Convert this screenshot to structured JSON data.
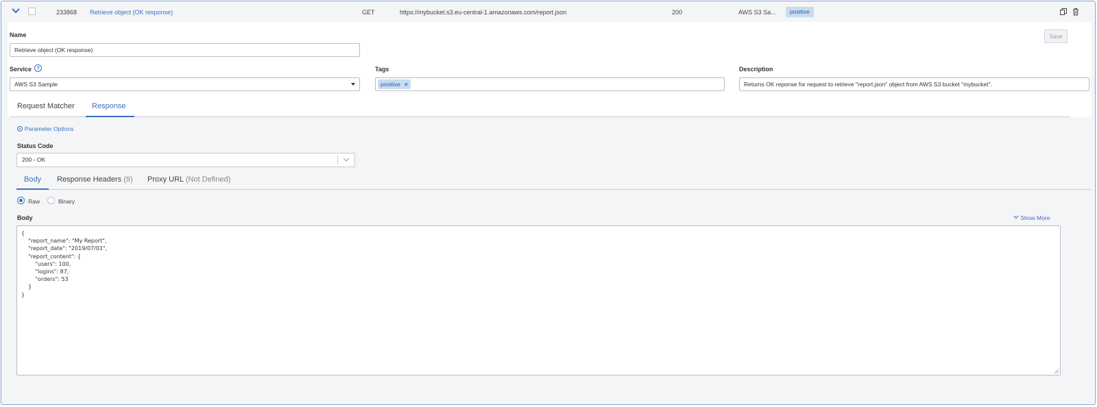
{
  "row": {
    "id": "233868",
    "name": "Retrieve object (OK response)",
    "method": "GET",
    "url": "https://mybucket.s3.eu-central-1.amazonaws.com/report.json",
    "status": "200",
    "service": "AWS S3 Sa...",
    "tag": "positive",
    "icons": [
      "chevron-down-icon",
      "copy-icon",
      "trash-icon"
    ]
  },
  "form": {
    "name_label": "Name",
    "name_value": "Retrieve object (OK response)",
    "save_label": "Save",
    "service_label": "Service",
    "service_value": "AWS S3 Sample",
    "tags_label": "Tags",
    "tags": [
      "positive"
    ],
    "tag_remove": "×",
    "description_label": "Description",
    "description_value": "Returns OK reponse for request to retrieve \"report.json\" object from AWS S3 bucket \"mybucket\"."
  },
  "tabs": {
    "request_matcher": "Request Matcher",
    "response": "Response"
  },
  "response": {
    "param_options": "Parameter Options",
    "status_code_label": "Status Code",
    "status_code_value": "200 - OK",
    "subtabs": {
      "body": "Body",
      "headers": "Response Headers",
      "headers_count": "(9)",
      "proxy": "Proxy URL",
      "proxy_state": "(Not Defined)"
    },
    "radio_raw": "Raw",
    "radio_binary": "Binary",
    "body_label": "Body",
    "show_more": "Show More",
    "body_text": "{\n    \"report_name\": \"My Report\",\n    \"report_date\": \"2019/07/01\",\n    \"report_content\": {\n        \"users\": 100,\n        \"logins\": 87,\n        \"orders\": 53\n    }\n}"
  },
  "colors": {
    "accent": "#3a70c4",
    "chip_bg": "#c9dcf3",
    "panel_bg": "#f4f5f7",
    "frame_border": "#7fa3d9"
  }
}
